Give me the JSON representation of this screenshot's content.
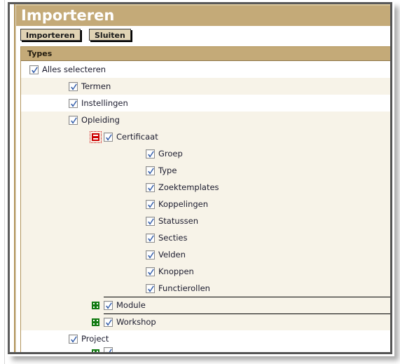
{
  "window": {
    "title": "Importeren"
  },
  "toolbar": {
    "import_label": "Importeren",
    "close_label": "Sluiten"
  },
  "panel": {
    "header_label": "Types"
  },
  "colors": {
    "title_bar": "#c4aa78",
    "panel_header": "#c4aa78",
    "row_alt": "#f7f3e8",
    "row_base": "#ffffff",
    "button_face": "#e0d3b4",
    "expand_icon": "#117a11",
    "collapse_icon": "#cc0000",
    "checkbox_tick": "#2f5aa8",
    "rail": "#b2945c",
    "window_frame": "#555555",
    "text": "#1b1b2e"
  },
  "tree": {
    "rows": [
      {
        "label": "Alles selecteren",
        "depth": 0,
        "indent": 12,
        "checked": true,
        "toggle": "none",
        "band": "white",
        "rule": "none"
      },
      {
        "label": "Termen",
        "depth": 1,
        "indent": 68,
        "checked": true,
        "toggle": "none",
        "band": "cream",
        "rule": "none"
      },
      {
        "label": "Instellingen",
        "depth": 1,
        "indent": 68,
        "checked": true,
        "toggle": "none",
        "band": "white",
        "rule": "none"
      },
      {
        "label": "Opleiding",
        "depth": 1,
        "indent": 68,
        "checked": true,
        "toggle": "none",
        "band": "cream",
        "rule": "none"
      },
      {
        "label": "Certificaat",
        "depth": 2,
        "indent": 118,
        "checked": true,
        "toggle": "minus",
        "toggle_icon": "collapse-minus-icon",
        "band": "cream",
        "rule": "none"
      },
      {
        "label": "Groep",
        "depth": 3,
        "indent": 178,
        "checked": true,
        "toggle": "none",
        "band": "cream",
        "rule": "none"
      },
      {
        "label": "Type",
        "depth": 3,
        "indent": 178,
        "checked": true,
        "toggle": "none",
        "band": "cream",
        "rule": "none"
      },
      {
        "label": "Zoektemplates",
        "depth": 3,
        "indent": 178,
        "checked": true,
        "toggle": "none",
        "band": "cream",
        "rule": "none"
      },
      {
        "label": "Koppelingen",
        "depth": 3,
        "indent": 178,
        "checked": true,
        "toggle": "none",
        "band": "cream",
        "rule": "none"
      },
      {
        "label": "Statussen",
        "depth": 3,
        "indent": 178,
        "checked": true,
        "toggle": "none",
        "band": "cream",
        "rule": "none"
      },
      {
        "label": "Secties",
        "depth": 3,
        "indent": 178,
        "checked": true,
        "toggle": "none",
        "band": "cream",
        "rule": "none"
      },
      {
        "label": "Velden",
        "depth": 3,
        "indent": 178,
        "checked": true,
        "toggle": "none",
        "band": "cream",
        "rule": "none"
      },
      {
        "label": "Knoppen",
        "depth": 3,
        "indent": 178,
        "checked": true,
        "toggle": "none",
        "band": "cream",
        "rule": "none"
      },
      {
        "label": "Functierollen",
        "depth": 3,
        "indent": 178,
        "checked": true,
        "toggle": "none",
        "band": "cream",
        "rule": "none"
      },
      {
        "label": "Module",
        "depth": 2,
        "indent": 118,
        "checked": true,
        "toggle": "plus",
        "toggle_icon": "expand-plus-icon",
        "band": "cream",
        "rule": "inset"
      },
      {
        "label": "Workshop",
        "depth": 2,
        "indent": 118,
        "checked": true,
        "toggle": "plus",
        "toggle_icon": "expand-plus-icon",
        "band": "cream",
        "rule": "inset"
      },
      {
        "label": "Project",
        "depth": 1,
        "indent": 68,
        "checked": true,
        "toggle": "none",
        "band": "white",
        "rule": "none"
      },
      {
        "label": "",
        "depth": 2,
        "indent": 118,
        "checked": true,
        "toggle": "plus",
        "toggle_icon": "expand-plus-icon",
        "band": "white",
        "rule": "none",
        "clipped": true
      }
    ]
  }
}
